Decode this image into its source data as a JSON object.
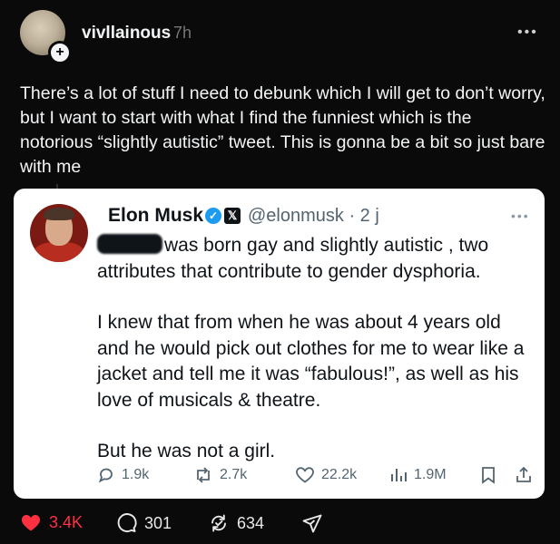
{
  "post": {
    "username": "vivllainous",
    "time": "7h",
    "text": "There’s a lot of stuff I need to debunk which I will get to don’t worry, but I want to start with what I find the funniest which is the notorious “slightly autistic” tweet. This is gonna be a bit so just bare with me",
    "more_icon": "more-horizontal-icon"
  },
  "quoted_tweet": {
    "name": "Elon Musk",
    "handle": "@elonmusk",
    "time": "· 2 j",
    "line1_after_redaction": "was born gay and slightly autistic , two attributes that contribute to gender dysphoria.",
    "paragraph2": "I knew that from when he was about 4 years old and he would pick out clothes for me to wear like a jacket and tell me it was “fabulous!”, as well as his love of musicals & theatre.",
    "paragraph3": "But he was not a girl.",
    "actions": {
      "replies": "1.9k",
      "retweets": "2.7k",
      "likes": "22.2k",
      "views": "1.9M"
    }
  },
  "actions": {
    "likes": "3.4K",
    "replies": "301",
    "reposts": "634"
  },
  "colors": {
    "background": "#0a0a0a",
    "like": "#ff3040",
    "verified": "#1d9bf0",
    "card": "#ffffff"
  }
}
